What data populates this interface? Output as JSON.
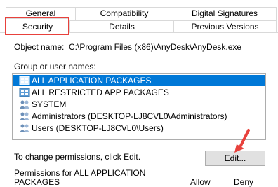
{
  "tabs": {
    "row1": [
      "General",
      "Compatibility",
      "Digital Signatures"
    ],
    "row2": [
      "Security",
      "Details",
      "Previous Versions"
    ]
  },
  "object": {
    "label": "Object name:",
    "value": "C:\\Program Files (x86)\\AnyDesk\\AnyDesk.exe"
  },
  "group_label": "Group or user names:",
  "users": [
    {
      "name": "ALL APPLICATION PACKAGES",
      "icon": "package-group-icon",
      "selected": true
    },
    {
      "name": "ALL RESTRICTED APP PACKAGES",
      "icon": "package-group-icon",
      "selected": false
    },
    {
      "name": "SYSTEM",
      "icon": "user-group-icon",
      "selected": false
    },
    {
      "name": "Administrators (DESKTOP-LJ8CVL0\\Administrators)",
      "icon": "user-group-icon",
      "selected": false
    },
    {
      "name": "Users (DESKTOP-LJ8CVL0\\Users)",
      "icon": "user-group-icon",
      "selected": false
    }
  ],
  "change_text": "To change permissions, click Edit.",
  "edit_button": "Edit...",
  "permissions": {
    "label_line1": "Permissions for ALL APPLICATION",
    "label_line2": "PACKAGES",
    "col_allow": "Allow",
    "col_deny": "Deny"
  },
  "colors": {
    "selection": "#0078d7",
    "highlight": "#e8413c",
    "arrow": "#e8413c"
  }
}
